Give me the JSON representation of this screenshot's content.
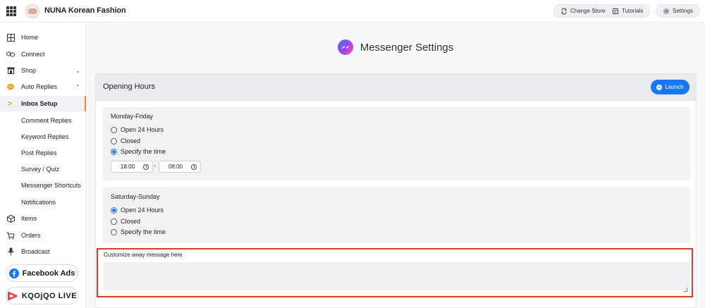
{
  "header": {
    "store_name": "NUNA Korean Fashion",
    "buttons": {
      "change_store": "Change Store",
      "tutorials": "Tutorials",
      "settings": "Settings"
    }
  },
  "sidebar": {
    "items": [
      {
        "label": "Home",
        "icon": "home-grid-icon"
      },
      {
        "label": "Connect",
        "icon": "link-icon"
      },
      {
        "label": "Shop",
        "icon": "shop-icon",
        "chevron": "down"
      },
      {
        "label": "Auto Replies",
        "icon": "chat-bubble-icon",
        "chevron": "up",
        "accent": "#f0a020"
      }
    ],
    "sub_items": [
      {
        "label": "Inbox Setup",
        "active": true
      },
      {
        "label": "Comment Replies"
      },
      {
        "label": "Keyword Replies"
      },
      {
        "label": "Post Replies"
      },
      {
        "label": "Survey / Quiz"
      },
      {
        "label": "Messenger Shortcuts"
      },
      {
        "label": "Notifications"
      }
    ],
    "items_after": [
      {
        "label": "Items",
        "icon": "box-icon"
      },
      {
        "label": "Orders",
        "icon": "cart-icon"
      },
      {
        "label": "Broadcast",
        "icon": "microphone-icon"
      }
    ],
    "facebook_ads": "Facebook Ads",
    "kaojao_live": "KQOjQO LIVE"
  },
  "page": {
    "title": "Messenger Settings"
  },
  "opening_hours": {
    "title": "Opening Hours",
    "launch_label": "Launch",
    "weekday": {
      "title": "Monday-Friday",
      "options": [
        "Open 24 Hours",
        "Closed",
        "Specify the time"
      ],
      "selected": "Specify the time",
      "start_time": "18:00",
      "separator": "-",
      "end_time": "08:00"
    },
    "weekend": {
      "title": "Saturday-Sunday",
      "options": [
        "Open 24 Hours",
        "Closed",
        "Specify the time"
      ],
      "selected": "Open 24 Hours"
    }
  },
  "away_message": {
    "label": "Customize away message here",
    "value": ""
  },
  "colors": {
    "accent_orange": "#f08a24",
    "primary_blue": "#1877f2",
    "highlight_red": "#e0392b"
  }
}
